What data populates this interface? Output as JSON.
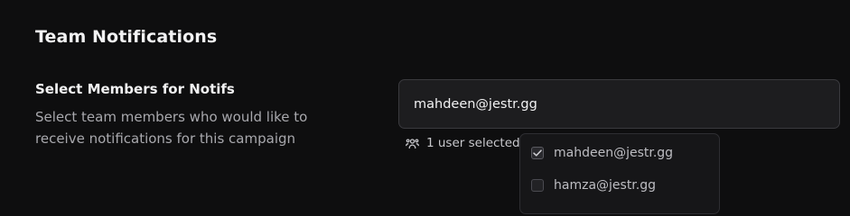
{
  "section": {
    "title": "Team Notifications"
  },
  "field": {
    "label": "Select Members for Notifs",
    "description": "Select team members who would like to receive notifications for this campaign"
  },
  "select": {
    "value": "mahdeen@jestr.gg"
  },
  "selection_summary": {
    "icon": "users-icon",
    "text": "1 user selected"
  },
  "dropdown": {
    "options": [
      {
        "label": "mahdeen@jestr.gg",
        "checked": true
      },
      {
        "label": "hamza@jestr.gg",
        "checked": false
      }
    ]
  }
}
